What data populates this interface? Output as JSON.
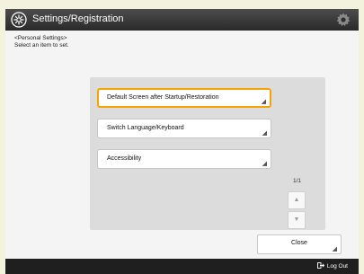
{
  "header": {
    "title": "Settings/Registration",
    "title_icon": "settings-circle-icon",
    "settings_icon": "gear-icon"
  },
  "instruction": {
    "line1": "<Personal Settings>",
    "line2": "Select an item to set."
  },
  "items": [
    {
      "label": "Default Screen after Startup/Restoration",
      "selected": true
    },
    {
      "label": "Switch Language/Keyboard",
      "selected": false
    },
    {
      "label": "Accessibility",
      "selected": false
    }
  ],
  "pagination": {
    "page": "1/1"
  },
  "buttons": {
    "close": "Close"
  },
  "footer": {
    "logout": "Log Out"
  },
  "colors": {
    "selection_border": "#f5a300",
    "titlebar": "#3a3a3a",
    "footer": "#1f1f1f"
  }
}
